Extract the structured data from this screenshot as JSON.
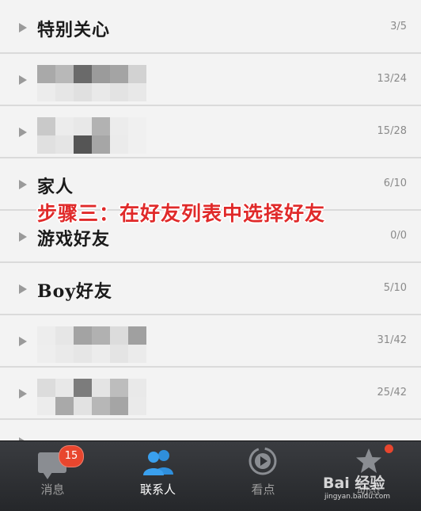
{
  "groups": [
    {
      "name": "特别关心",
      "count": "3/5"
    },
    {
      "name": "",
      "count": "13/24"
    },
    {
      "name": "",
      "count": "15/28"
    },
    {
      "name": "家人",
      "count": "6/10"
    },
    {
      "name": "游戏好友",
      "count": "0/0"
    },
    {
      "name": "Boy好友",
      "count": "5/10"
    },
    {
      "name": "",
      "count": "31/42"
    },
    {
      "name": "",
      "count": "25/42"
    }
  ],
  "overlay_text": "步骤三：在好友列表中选择好友",
  "tabs": [
    {
      "label": "消息",
      "badge": "15"
    },
    {
      "label": "联系人"
    },
    {
      "label": "看点"
    },
    {
      "label": "动态"
    }
  ],
  "watermark": {
    "brand": "Bai 经验",
    "site": "jingyan.baidu.com"
  },
  "colors": {
    "accent": "#e8462e",
    "active_icon": "#2f8fdc",
    "overlay": "#e02a2a"
  }
}
